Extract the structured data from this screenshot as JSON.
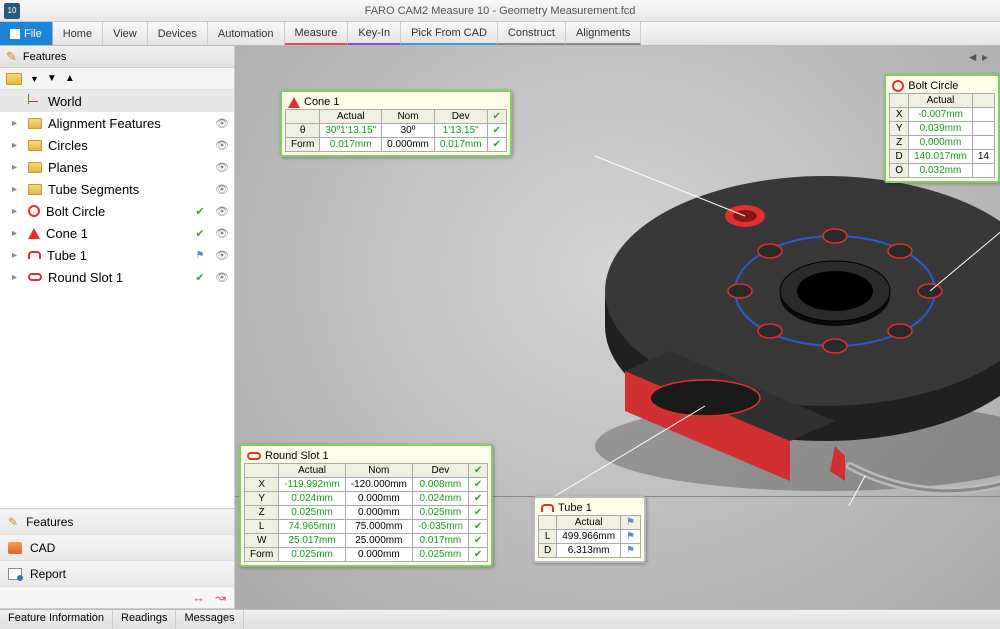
{
  "titlebar": {
    "text": "FARO CAM2 Measure 10 - Geometry Measurement.fcd",
    "app_icon_text": "10"
  },
  "ribbon": {
    "file": "File",
    "tabs": [
      "Home",
      "View",
      "Devices",
      "Automation",
      "Measure",
      "Key-In",
      "Pick From CAD",
      "Construct",
      "Alignments"
    ]
  },
  "sidebar": {
    "features_label": "Features",
    "tree": [
      {
        "icon": "axes",
        "label": "World",
        "eye": false,
        "check": false,
        "flag": false,
        "chev": ""
      },
      {
        "icon": "folder",
        "label": "Alignment Features",
        "eye": true,
        "check": false,
        "flag": false,
        "chev": "▸"
      },
      {
        "icon": "folder",
        "label": "Circles",
        "eye": true,
        "check": false,
        "flag": false,
        "chev": "▸"
      },
      {
        "icon": "folder",
        "label": "Planes",
        "eye": true,
        "check": false,
        "flag": false,
        "chev": "▸"
      },
      {
        "icon": "folder",
        "label": "Tube Segments",
        "eye": true,
        "check": false,
        "flag": false,
        "chev": "▸"
      },
      {
        "icon": "circle",
        "label": "Bolt Circle",
        "eye": true,
        "check": true,
        "flag": false,
        "chev": "▸"
      },
      {
        "icon": "cone",
        "label": "Cone 1",
        "eye": true,
        "check": true,
        "flag": false,
        "chev": "▸"
      },
      {
        "icon": "tube",
        "label": "Tube 1",
        "eye": true,
        "check": false,
        "flag": true,
        "chev": "▸"
      },
      {
        "icon": "slot",
        "label": "Round Slot 1",
        "eye": true,
        "check": true,
        "flag": false,
        "chev": "▸"
      }
    ],
    "panels": {
      "features": "Features",
      "cad": "CAD",
      "report": "Report"
    }
  },
  "status": {
    "tabs": [
      "Feature Information",
      "Readings",
      "Messages"
    ]
  },
  "callouts": {
    "cone1": {
      "title": "Cone 1",
      "cols": [
        "Actual",
        "Nom",
        "Dev"
      ],
      "rows": [
        {
          "k": "θ",
          "a": "30º1'13.15\"",
          "n": "30º",
          "d": "1'13.15\""
        },
        {
          "k": "Form",
          "a": "0.017mm",
          "n": "0.000mm",
          "d": "0.017mm"
        }
      ]
    },
    "bolt": {
      "title": "Bolt Circle",
      "cols": [
        "Actual"
      ],
      "rows": [
        {
          "k": "X",
          "a": "-0.007mm"
        },
        {
          "k": "Y",
          "a": "0.039mm"
        },
        {
          "k": "Z",
          "a": "0.000mm"
        },
        {
          "k": "D",
          "a": "140.017mm",
          "extra": "14"
        },
        {
          "k": "O",
          "a": "0.032mm"
        }
      ]
    },
    "slot": {
      "title": "Round Slot 1",
      "cols": [
        "Actual",
        "Nom",
        "Dev"
      ],
      "rows": [
        {
          "k": "X",
          "a": "-119.992mm",
          "n": "-120.000mm",
          "d": "0.008mm"
        },
        {
          "k": "Y",
          "a": "0.024mm",
          "n": "0.000mm",
          "d": "0.024mm"
        },
        {
          "k": "Z",
          "a": "0.025mm",
          "n": "0.000mm",
          "d": "0.025mm"
        },
        {
          "k": "L",
          "a": "74.965mm",
          "n": "75.000mm",
          "d": "-0.035mm"
        },
        {
          "k": "W",
          "a": "25.017mm",
          "n": "25.000mm",
          "d": "0.017mm"
        },
        {
          "k": "Form",
          "a": "0.025mm",
          "n": "0.000mm",
          "d": "0.025mm"
        }
      ]
    },
    "tube": {
      "title": "Tube 1",
      "cols": [
        "Actual"
      ],
      "rows": [
        {
          "k": "L",
          "a": "499.966mm"
        },
        {
          "k": "D",
          "a": "6.313mm"
        }
      ]
    }
  }
}
